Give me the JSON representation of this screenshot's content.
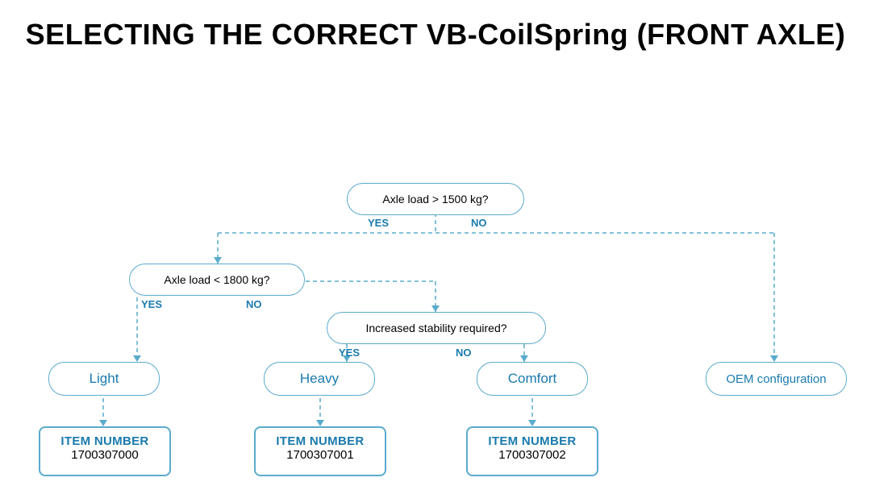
{
  "title": "SELECTING THE CORRECT VB-CoilSpring (FRONT AXLE)",
  "decision1": {
    "text": "Axle load > 1500 kg?",
    "yes": "YES",
    "no": "NO"
  },
  "decision2": {
    "text": "Axle load < 1800 kg?",
    "yes": "YES",
    "no": "NO"
  },
  "decision3": {
    "text": "Increased stability required?",
    "yes": "YES",
    "no": "NO"
  },
  "results": {
    "light": "Light",
    "heavy": "Heavy",
    "comfort": "Comfort",
    "oem": "OEM configuration"
  },
  "items": {
    "item0": {
      "label": "ITEM NUMBER",
      "number": "1700307000"
    },
    "item1": {
      "label": "ITEM NUMBER",
      "number": "1700307001"
    },
    "item2": {
      "label": "ITEM NUMBER",
      "number": "1700307002"
    }
  }
}
